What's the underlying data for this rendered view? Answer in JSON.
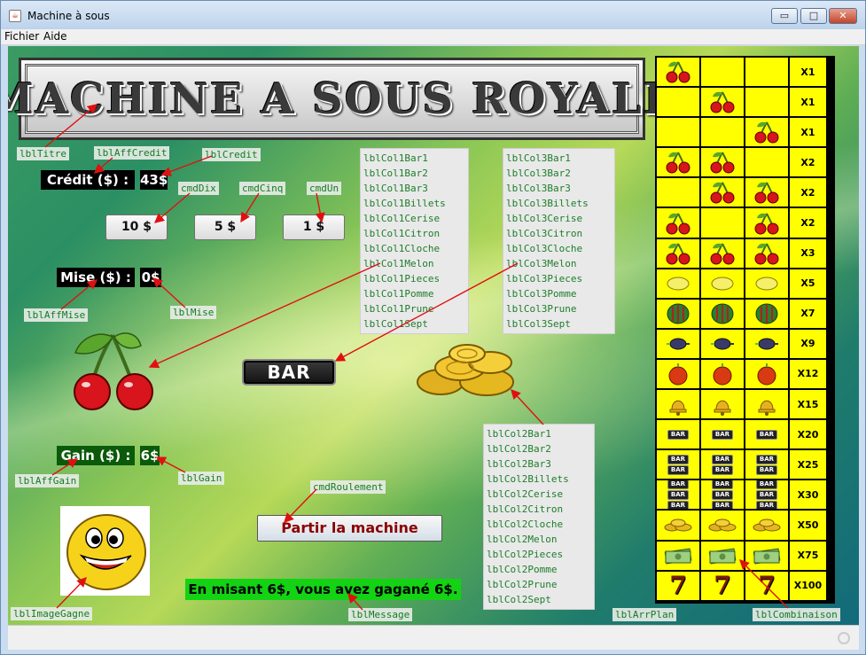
{
  "window": {
    "title": "Machine à sous",
    "minimize": "▭",
    "maximize": "□",
    "close": "✕"
  },
  "menu": {
    "file": "Fichier",
    "help": "Aide"
  },
  "title_banner": "MACHINE A SOUS ROYALE",
  "credit": {
    "label": "Crédit ($) :",
    "value": "43$"
  },
  "bet_buttons": {
    "ten": "10 $",
    "five": "5 $",
    "one": "1 $"
  },
  "bet": {
    "label": "Mise ($) :",
    "value": "0$"
  },
  "gain": {
    "label": "Gain ($) :",
    "value": "6$"
  },
  "reel_bar_symbol": "BAR",
  "spin_button": "Partir la machine",
  "message": "En misant 6$, vous avez gagané 6$.",
  "component_labels": {
    "lblTitre": "lblTitre",
    "lblAffCredit": "lblAffCredit",
    "lblCredit": "lblCredit",
    "cmdDix": "cmdDix",
    "cmdCinq": "cmdCinq",
    "cmdUn": "cmdUn",
    "lblAffMise": "lblAffMise",
    "lblMise": "lblMise",
    "lblAffGain": "lblAffGain",
    "lblGain": "lblGain",
    "cmdRoulement": "cmdRoulement",
    "lblImageGagne": "lblImageGagne",
    "lblMessage": "lblMessage",
    "lblArrPlan": "lblArrPlan",
    "lblCombinaison": "lblCombinaison"
  },
  "col1_labels": [
    "lblCol1Bar1",
    "lblCol1Bar2",
    "lblCol1Bar3",
    "lblCol1Billets",
    "lblCol1Cerise",
    "lblCol1Citron",
    "lblCol1Cloche",
    "lblCol1Melon",
    "lblCol1Pieces",
    "lblCol1Pomme",
    "lblCol1Prune",
    "lblCol1Sept"
  ],
  "col2_labels": [
    "lblCol2Bar1",
    "lblCol2Bar2",
    "lblCol2Bar3",
    "lblCol2Billets",
    "lblCol2Cerise",
    "lblCol2Citron",
    "lblCol2Cloche",
    "lblCol2Melon",
    "lblCol2Pieces",
    "lblCol2Pomme",
    "lblCol2Prune",
    "lblCol2Sept"
  ],
  "col3_labels": [
    "lblCol3Bar1",
    "lblCol3Bar2",
    "lblCol3Bar3",
    "lblCol3Billets",
    "lblCol3Cerise",
    "lblCol3Citron",
    "lblCol3Cloche",
    "lblCol3Melon",
    "lblCol3Pieces",
    "lblCol3Pomme",
    "lblCol3Prune",
    "lblCol3Sept"
  ],
  "paytable": [
    {
      "symbols": [
        "cherry",
        "",
        ""
      ],
      "mult": "X1"
    },
    {
      "symbols": [
        "",
        "cherry",
        ""
      ],
      "mult": "X1"
    },
    {
      "symbols": [
        "",
        "",
        "cherry"
      ],
      "mult": "X1"
    },
    {
      "symbols": [
        "cherry",
        "cherry",
        ""
      ],
      "mult": "X2"
    },
    {
      "symbols": [
        "",
        "cherry",
        "cherry"
      ],
      "mult": "X2"
    },
    {
      "symbols": [
        "cherry",
        "",
        "cherry"
      ],
      "mult": "X2"
    },
    {
      "symbols": [
        "cherry",
        "cherry",
        "cherry"
      ],
      "mult": "X3"
    },
    {
      "symbols": [
        "lemon",
        "lemon",
        "lemon"
      ],
      "mult": "X5"
    },
    {
      "symbols": [
        "melon",
        "melon",
        "melon"
      ],
      "mult": "X7"
    },
    {
      "symbols": [
        "plum",
        "plum",
        "plum"
      ],
      "mult": "X9"
    },
    {
      "symbols": [
        "apple",
        "apple",
        "apple"
      ],
      "mult": "X12"
    },
    {
      "symbols": [
        "bell",
        "bell",
        "bell"
      ],
      "mult": "X15"
    },
    {
      "symbols": [
        "bar1",
        "bar1",
        "bar1"
      ],
      "mult": "X20"
    },
    {
      "symbols": [
        "bar2",
        "bar2",
        "bar2"
      ],
      "mult": "X25"
    },
    {
      "symbols": [
        "bar3",
        "bar3",
        "bar3"
      ],
      "mult": "X30"
    },
    {
      "symbols": [
        "coins",
        "coins",
        "coins"
      ],
      "mult": "X50"
    },
    {
      "symbols": [
        "bills",
        "bills",
        "bills"
      ],
      "mult": "X75"
    },
    {
      "symbols": [
        "seven",
        "seven",
        "seven"
      ],
      "mult": "X100"
    }
  ],
  "colors": {
    "reel_bg": "#ffff00",
    "message_bg": "#14d214",
    "gain_bg": "#0a5a0a",
    "spin_text": "#8b0000"
  }
}
